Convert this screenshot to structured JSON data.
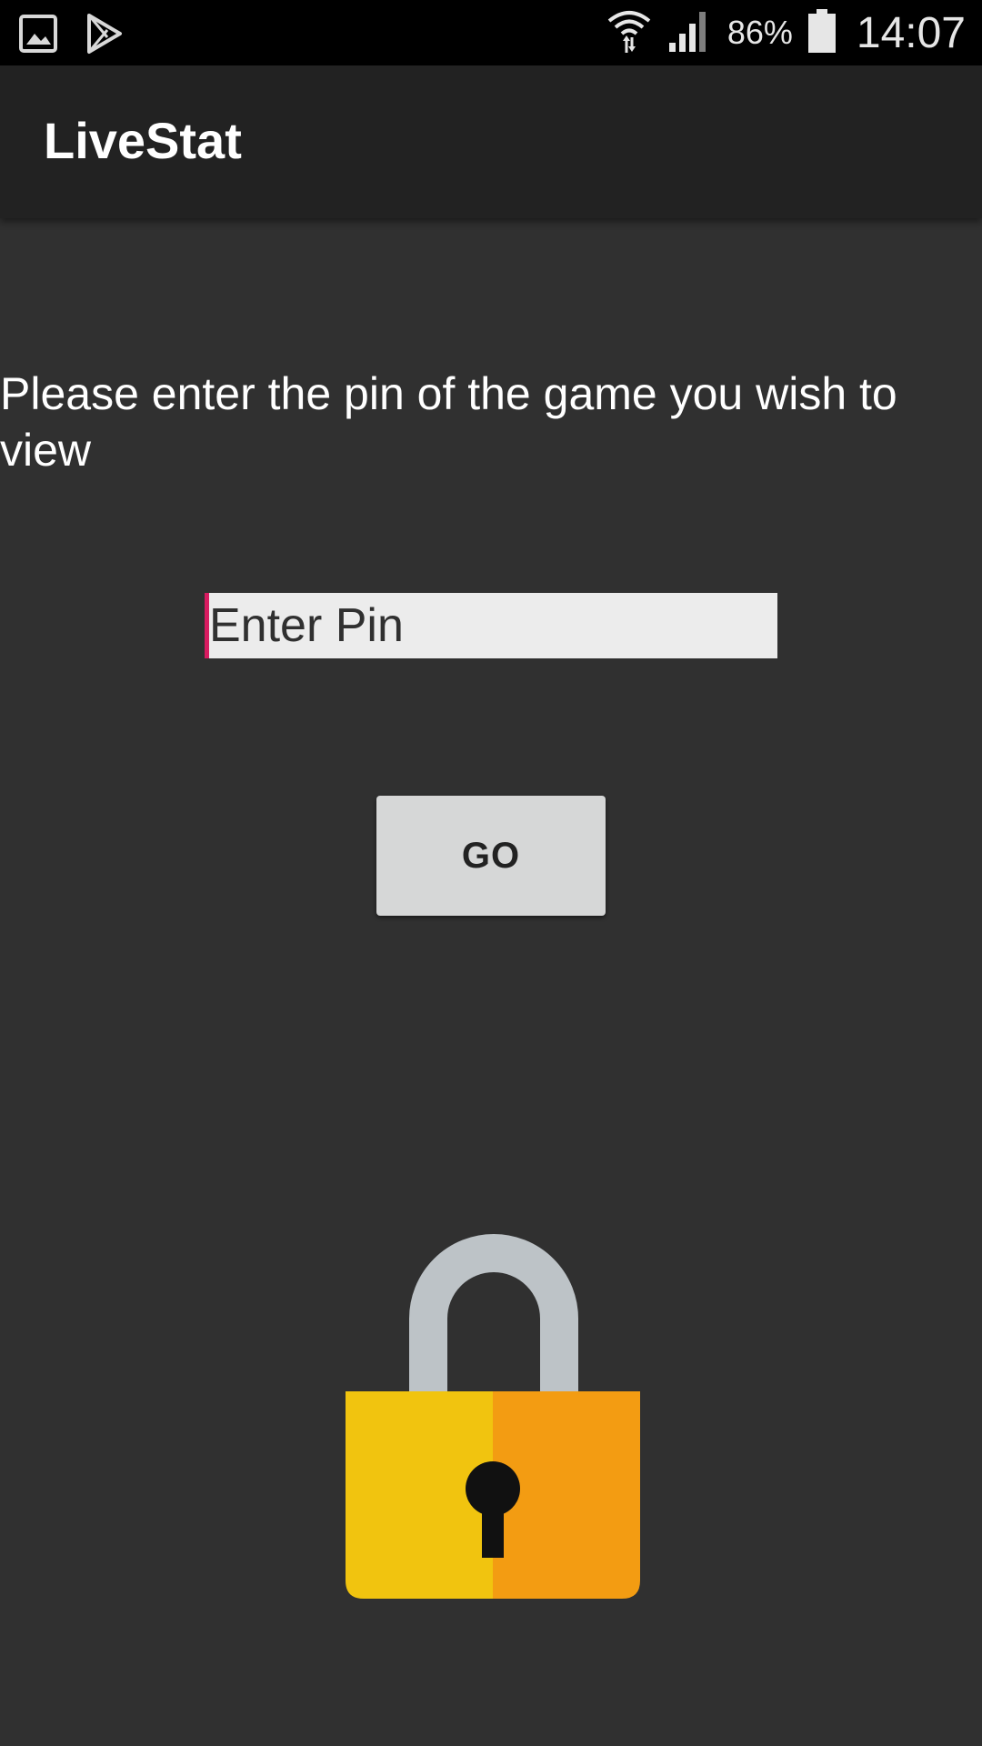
{
  "status_bar": {
    "battery_percent": "86%",
    "time": "14:07",
    "icons": [
      "gallery-icon",
      "play-store-icon",
      "wifi-icon",
      "signal-icon",
      "battery-icon"
    ]
  },
  "app_bar": {
    "title": "LiveStat"
  },
  "main": {
    "prompt": "Please enter the pin of the game you wish to view",
    "pin_input": {
      "placeholder": "Enter Pin",
      "value": ""
    },
    "go_button_label": "GO",
    "lock_icon": "padlock-icon"
  },
  "colors": {
    "background": "#303030",
    "app_bar": "#222222",
    "status_bar": "#000000",
    "input_accent": "#d81b60",
    "button": "#d6d7d7",
    "lock_shackle": "#bdc3c7",
    "lock_body_left": "#f1c40f",
    "lock_body_right": "#f39c12"
  }
}
